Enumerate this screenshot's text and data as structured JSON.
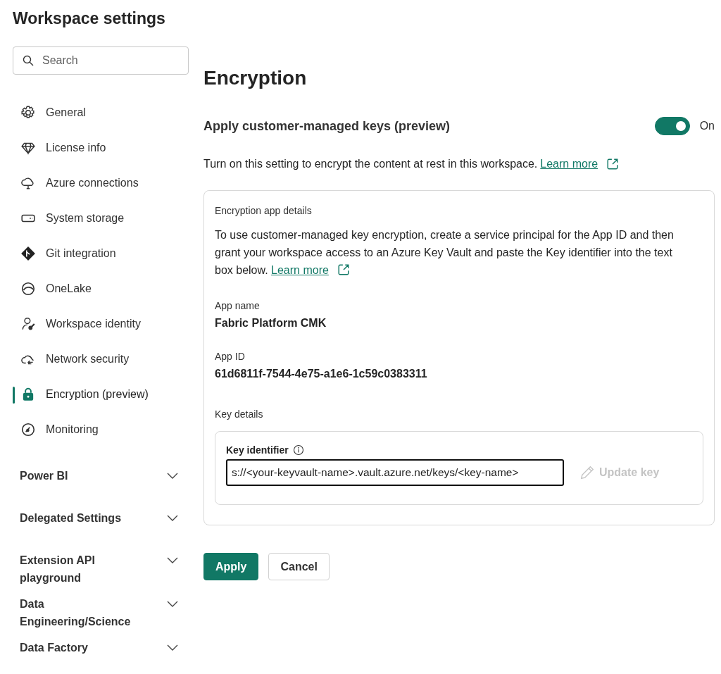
{
  "window": {
    "title": "Workspace settings"
  },
  "search": {
    "placeholder": "Search"
  },
  "nav": [
    {
      "label": "General",
      "selected": false
    },
    {
      "label": "License info",
      "selected": false
    },
    {
      "label": "Azure connections",
      "selected": false
    },
    {
      "label": "System storage",
      "selected": false
    },
    {
      "label": "Git integration",
      "selected": false
    },
    {
      "label": "OneLake",
      "selected": false
    },
    {
      "label": "Workspace identity",
      "selected": false
    },
    {
      "label": "Network security",
      "selected": false
    },
    {
      "label": "Encryption (preview)",
      "selected": true
    },
    {
      "label": "Monitoring",
      "selected": false
    }
  ],
  "sections": [
    {
      "label": "Power BI",
      "expanded": false
    },
    {
      "label": "Delegated Settings",
      "expanded": false
    },
    {
      "label": "Extension API playground",
      "expanded": false
    },
    {
      "label": "Data Engineering/Science",
      "expanded": false
    },
    {
      "label": "Data Factory",
      "expanded": false
    }
  ],
  "page": {
    "heading": "Encryption",
    "setting": {
      "label": "Apply customer-managed keys (preview)",
      "on": true,
      "state_label": "On"
    },
    "description": "Turn on this setting to encrypt the content at rest in this workspace.",
    "description_link": "Learn more",
    "card": {
      "title": "Encryption app details",
      "text": "To use customer-managed key encryption, create a service principal for the App ID and then grant your workspace access to an Azure Key Vault and paste the Key identifier into the text box below.",
      "text_link": "Learn more",
      "fields": [
        {
          "label": "App name",
          "value": "Fabric Platform CMK"
        },
        {
          "label": "App ID",
          "value": "61d6811f-7544-4e75-a1e6-1c59c0383311"
        }
      ],
      "key_section": "Key details",
      "key_label": "Key identifier",
      "key_value": "s://<your-keyvault-name>.vault.azure.net/keys/<key-name>",
      "update_button": {
        "label": "Update key",
        "disabled": true
      }
    }
  },
  "buttons": [
    {
      "label": "Apply",
      "kind": "primary"
    },
    {
      "label": "Cancel",
      "kind": "secondary"
    }
  ]
}
